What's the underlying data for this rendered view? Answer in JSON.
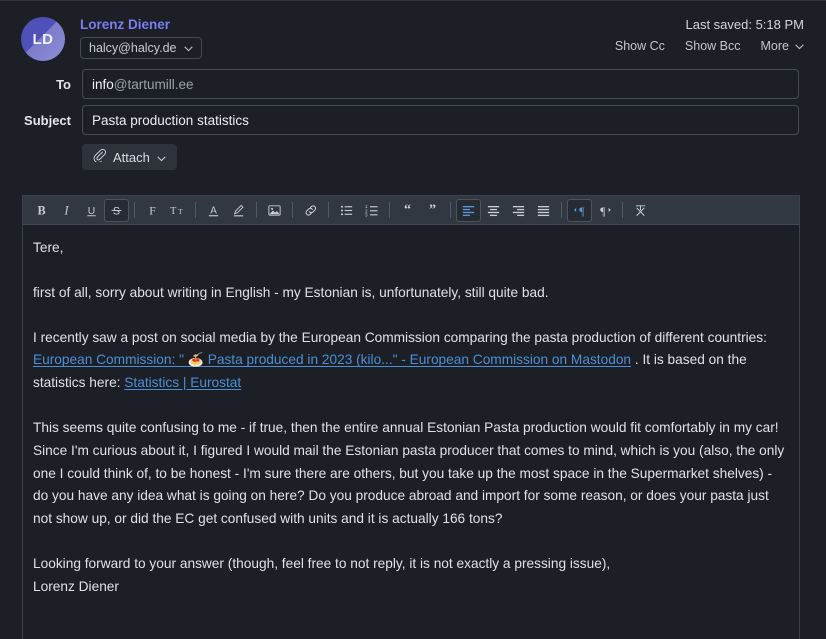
{
  "header": {
    "avatar_initials": "LD",
    "sender_name": "Lorenz Diener",
    "identity_email": "halcy@halcy.de",
    "last_saved": "Last saved: 5:18 PM",
    "show_cc": "Show Cc",
    "show_bcc": "Show Bcc",
    "more": "More",
    "accent_color": "#7b7cf0"
  },
  "fields": {
    "to_label": "To",
    "to_local": "info",
    "to_domain": "@tartumill.ee",
    "to_placeholder": "To",
    "subject_label": "Subject",
    "subject_value": "Pasta production statistics",
    "subject_placeholder": "Subject"
  },
  "attach": {
    "label": "Attach"
  },
  "toolbar": {
    "bold": "B",
    "italic": "I",
    "underline": "U",
    "strikethrough": "S",
    "font": "F",
    "font_size": "Tt",
    "active_color": "#5b9bd8",
    "items": [
      {
        "name": "bold-button",
        "active": false
      },
      {
        "name": "italic-button",
        "active": false
      },
      {
        "name": "underline-button",
        "active": false
      },
      {
        "name": "strikethrough-button",
        "active": true
      },
      {
        "name": "font-family-button",
        "active": false
      },
      {
        "name": "font-size-button",
        "active": false
      },
      {
        "name": "text-color-button",
        "active": false
      },
      {
        "name": "highlight-color-button",
        "active": false
      },
      {
        "name": "insert-image-button",
        "active": false
      },
      {
        "name": "insert-link-button",
        "active": false
      },
      {
        "name": "bullet-list-button",
        "active": false
      },
      {
        "name": "numbered-list-button",
        "active": false
      },
      {
        "name": "blockquote-open-button",
        "active": false
      },
      {
        "name": "blockquote-close-button",
        "active": false
      },
      {
        "name": "align-left-button",
        "active": true
      },
      {
        "name": "align-center-button",
        "active": false
      },
      {
        "name": "align-right-button",
        "active": false
      },
      {
        "name": "align-justify-button",
        "active": false
      },
      {
        "name": "direction-ltr-button",
        "active": true
      },
      {
        "name": "direction-rtl-button",
        "active": false
      },
      {
        "name": "clear-formatting-button",
        "active": false
      }
    ]
  },
  "body": {
    "p1": "Tere,",
    "p2": "first of all, sorry about writing in English - my Estonian is, unfortunately, still quite bad.",
    "p3_pre": "I recently saw a post on social media by the European Commission comparing the pasta production of different countries: ",
    "p3_link1_pre": "European Commission: \" ",
    "p3_link1_emoji": "🍝",
    "p3_link1_post": " Pasta produced in 2023 (kilo...\" - European Commission on Mastodon",
    "p3_mid": " . It is based on the statistics here: ",
    "p3_link2": "Statistics | Eurostat",
    "p4": "This seems quite confusing to me - if true, then the entire annual Estonian Pasta production would fit comfortably in my car! Since I'm curious about it, I figured I would mail the Estonian pasta producer that comes to mind, which is you (also, the only one I could think of, to be honest - I'm sure there are others, but you take up the most space in the Supermarket shelves) - do you have any idea what is going on here? Do you produce abroad and import for some reason, or does your pasta just not show up, or did the EC get confused with units and it is actually 166 tons?",
    "p5_line1": "Looking forward to your answer (though, feel free to not reply, it is not exactly a pressing issue),",
    "p5_line2": "Lorenz Diener",
    "link_color": "#4d8fd6"
  }
}
